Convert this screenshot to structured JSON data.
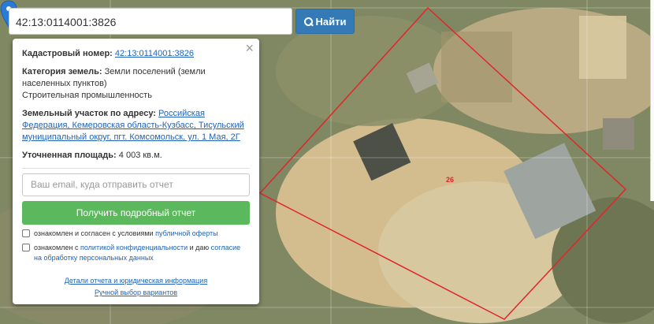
{
  "search": {
    "value": "42:13:0114001:3826",
    "button_label": "Найти"
  },
  "popup": {
    "close_glyph": "×",
    "cadastral_label": "Кадастровый номер:",
    "cadastral_value": "42:13:0114001:3826",
    "land_category_label": "Категория земель:",
    "land_category_value": "Земли поселений (земли населенных пунктов)",
    "usage_value": "Строительная промышленность",
    "address_label": "Земельный участок по адресу:",
    "address_value": "Российская Федерация, Кемеровская область-Кузбасс, Тисульский муниципальный округ, пгт. Комсомольск, ул. 1 Мая, 2Г",
    "area_label": "Уточненная площадь:",
    "area_value": "4 003 кв.м.",
    "email_placeholder": "Ваш email, куда отправить отчет",
    "get_report_button": "Получить подробный отчет",
    "consent1_text": "ознакомлен и согласен с условиями",
    "consent1_link": "публичной оферты",
    "consent2_text": "ознакомлен с",
    "consent2_link1": "политикой конфиденциальности",
    "consent2_mid": "и даю",
    "consent2_link2": "согласие на обработку персональных данных",
    "details_link": "Детали отчета и юридическая информация",
    "manual_link": "Ручной выбор вариантов"
  },
  "map": {
    "parcel_number_fragment": "26",
    "parcel_color": "#e0262b",
    "marker_color": "#2b7bd6"
  }
}
